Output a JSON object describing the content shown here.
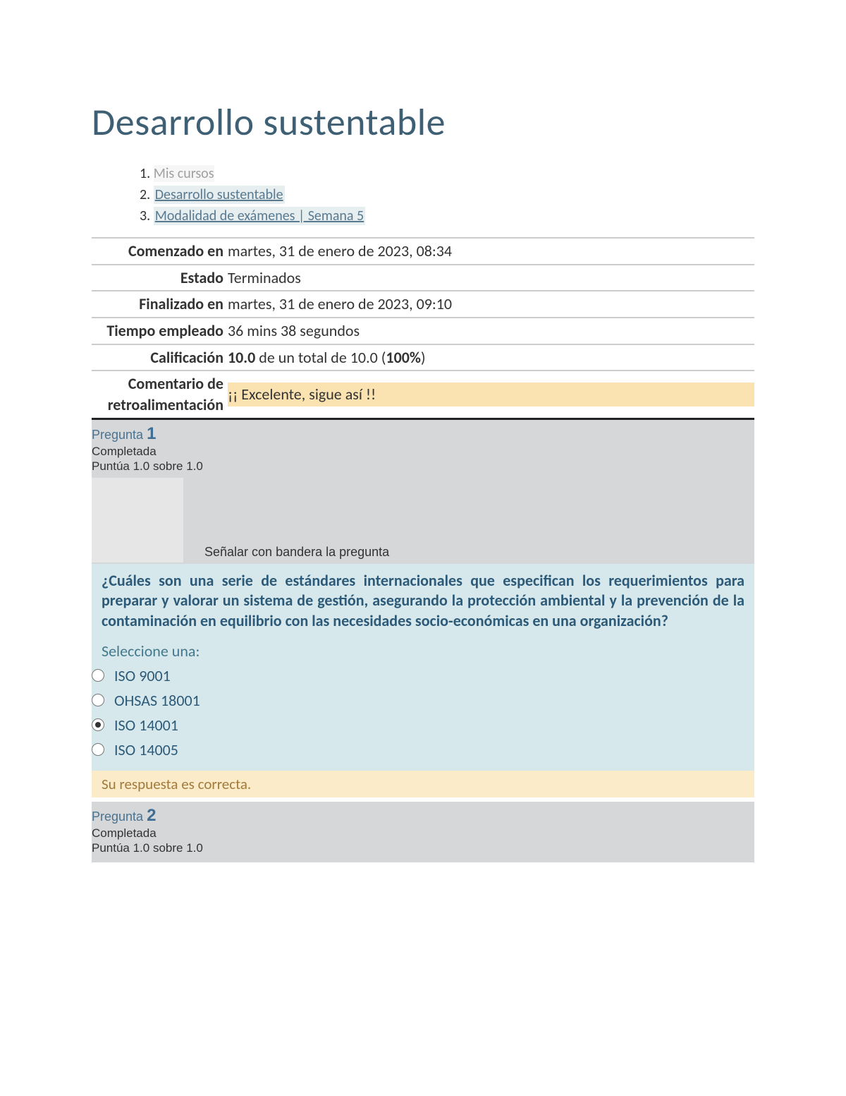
{
  "course_title": "Desarrollo sustentable",
  "breadcrumbs": [
    {
      "label": "Mis cursos",
      "active": false
    },
    {
      "label": "Desarrollo sustentable",
      "active": true
    },
    {
      "label": "Modalidad de exámenes | Semana 5",
      "active": true
    }
  ],
  "summary": {
    "started_label": "Comenzado en",
    "started_value": "martes, 31 de enero de 2023, 08:34",
    "state_label": "Estado",
    "state_value": "Terminados",
    "finished_label": "Finalizado en",
    "finished_value": "martes, 31 de enero de 2023, 09:10",
    "time_label": "Tiempo empleado",
    "time_value": "36 mins 38 segundos",
    "grade_label": "Calificación",
    "grade_score": "10.0",
    "grade_mid": " de un total de 10.0 (",
    "grade_pct": "100%",
    "grade_close": ")",
    "feedback_label": "Comentario de retroalimentación",
    "feedback_value": "¡¡ Excelente, sigue así !!"
  },
  "q1": {
    "pregunta_word": "Pregunta ",
    "number": "1",
    "status": "Completada",
    "score_line": "Puntúa 1.0 sobre 1.0",
    "flag_text": "Señalar con bandera la pregunta",
    "qtext": "¿Cuáles son una serie de estándares internacionales que especifican los requerimientos para preparar y valorar un sistema de gestión, asegurando la protección ambiental y la prevención de la contaminación en equilibrio con las necesidades socio-económicas en una organización?",
    "select_label": "Seleccione una:",
    "answers": [
      {
        "label": "ISO 9001",
        "checked": false
      },
      {
        "label": "OHSAS 18001",
        "checked": false
      },
      {
        "label": "ISO 14001",
        "checked": true
      },
      {
        "label": "ISO 14005",
        "checked": false
      }
    ],
    "response_feedback": "Su respuesta es correcta."
  },
  "q2": {
    "pregunta_word": "Pregunta ",
    "number": "2",
    "status": "Completada",
    "score_line": "Puntúa 1.0 sobre 1.0"
  }
}
